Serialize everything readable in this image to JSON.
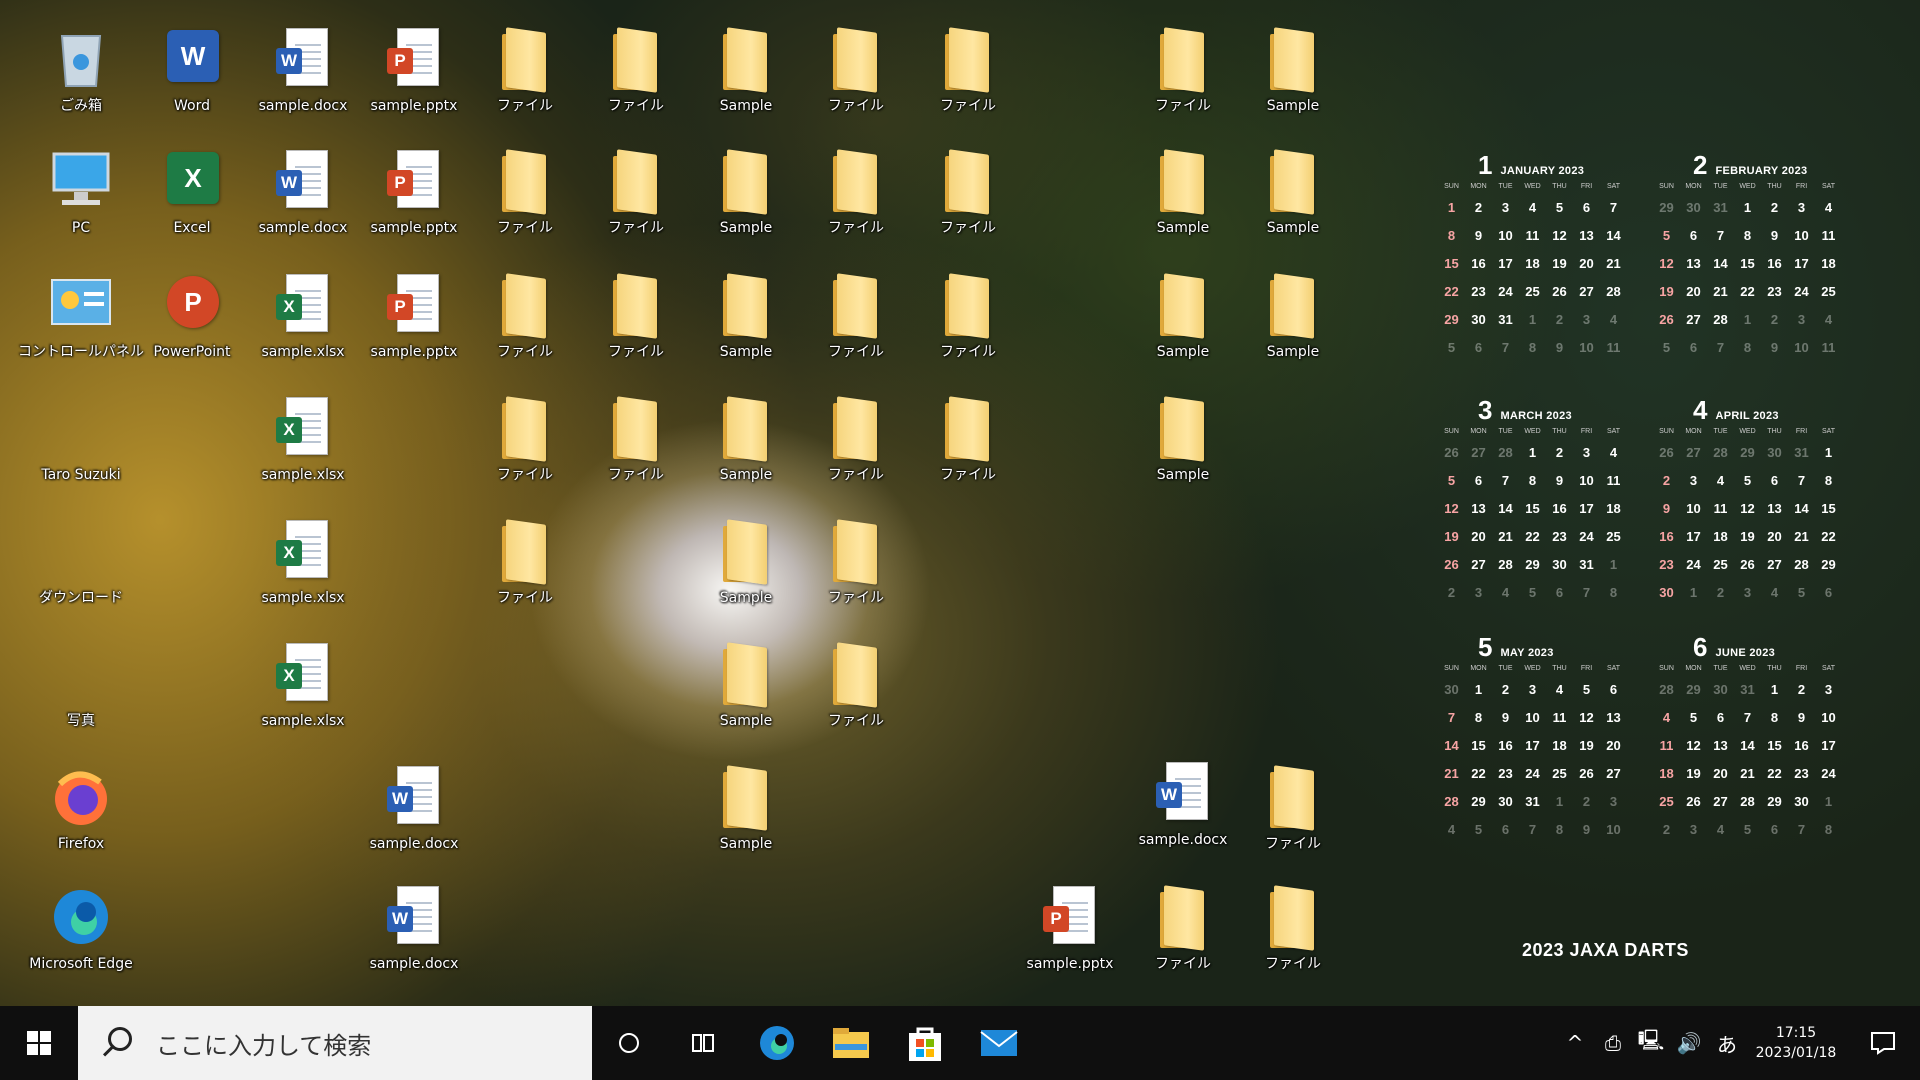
{
  "desktop": {
    "col1": [
      {
        "label": "ごみ箱",
        "icon": "recycle-bin-icon",
        "kind": "bin"
      },
      {
        "label": "PC",
        "icon": "pc-icon",
        "kind": "pc"
      },
      {
        "label": "コントロールパネル",
        "icon": "control-panel-icon",
        "kind": "cp"
      },
      {
        "label": "Taro Suzuki",
        "icon": "user-folder-icon",
        "kind": "folder"
      },
      {
        "label": "ダウンロード",
        "icon": "downloads-folder-icon",
        "kind": "folder"
      },
      {
        "label": "写真",
        "icon": "pictures-folder-icon",
        "kind": "folder"
      },
      {
        "label": "Firefox",
        "icon": "firefox-icon",
        "kind": "firefox"
      },
      {
        "label": "Microsoft Edge",
        "icon": "edge-icon",
        "kind": "edge"
      }
    ],
    "col2": [
      {
        "label": "Word",
        "icon": "word-app-icon"
      },
      {
        "label": "Excel",
        "icon": "excel-app-icon"
      },
      {
        "label": "PowerPoint",
        "icon": "powerpoint-app-icon"
      }
    ],
    "col3": [
      "sample.docx",
      "sample.docx",
      "sample.xlsx",
      "sample.xlsx",
      "sample.xlsx",
      "sample.xlsx"
    ],
    "col4": [
      "sample.pptx",
      "sample.pptx",
      "sample.pptx",
      "sample.docx",
      "sample.docx"
    ],
    "folders": {
      "file_label": "ファイル",
      "sample_label": "Sample"
    },
    "bottom_right": [
      "sample.docx",
      "ファイル",
      "sample.pptx",
      "ファイル",
      "ファイル"
    ]
  },
  "calendar": {
    "dow": [
      "SUN",
      "MON",
      "TUE",
      "WED",
      "THU",
      "FRI",
      "SAT"
    ],
    "months": [
      {
        "num": "1",
        "name": "JANUARY 2023",
        "weeks": [
          [
            "1",
            "2",
            "3",
            "4",
            "5",
            "6",
            "7"
          ],
          [
            "8",
            "9",
            "10",
            "11",
            "12",
            "13",
            "14"
          ],
          [
            "15",
            "16",
            "17",
            "18",
            "19",
            "20",
            "21"
          ],
          [
            "22",
            "23",
            "24",
            "25",
            "26",
            "27",
            "28"
          ],
          [
            "29",
            "30",
            "31",
            "1",
            "2",
            "3",
            "4"
          ],
          [
            "5",
            "6",
            "7",
            "8",
            "9",
            "10",
            "11"
          ]
        ]
      },
      {
        "num": "2",
        "name": "FEBRUARY 2023",
        "weeks": [
          [
            "29",
            "30",
            "31",
            "1",
            "2",
            "3",
            "4"
          ],
          [
            "5",
            "6",
            "7",
            "8",
            "9",
            "10",
            "11"
          ],
          [
            "12",
            "13",
            "14",
            "15",
            "16",
            "17",
            "18"
          ],
          [
            "19",
            "20",
            "21",
            "22",
            "23",
            "24",
            "25"
          ],
          [
            "26",
            "27",
            "28",
            "1",
            "2",
            "3",
            "4"
          ],
          [
            "5",
            "6",
            "7",
            "8",
            "9",
            "10",
            "11"
          ]
        ]
      },
      {
        "num": "3",
        "name": "MARCH 2023",
        "weeks": [
          [
            "26",
            "27",
            "28",
            "1",
            "2",
            "3",
            "4"
          ],
          [
            "5",
            "6",
            "7",
            "8",
            "9",
            "10",
            "11"
          ],
          [
            "12",
            "13",
            "14",
            "15",
            "16",
            "17",
            "18"
          ],
          [
            "19",
            "20",
            "21",
            "22",
            "23",
            "24",
            "25"
          ],
          [
            "26",
            "27",
            "28",
            "29",
            "30",
            "31",
            "1"
          ],
          [
            "2",
            "3",
            "4",
            "5",
            "6",
            "7",
            "8"
          ]
        ]
      },
      {
        "num": "4",
        "name": "APRIL 2023",
        "weeks": [
          [
            "26",
            "27",
            "28",
            "29",
            "30",
            "31",
            "1"
          ],
          [
            "2",
            "3",
            "4",
            "5",
            "6",
            "7",
            "8"
          ],
          [
            "9",
            "10",
            "11",
            "12",
            "13",
            "14",
            "15"
          ],
          [
            "16",
            "17",
            "18",
            "19",
            "20",
            "21",
            "22"
          ],
          [
            "23",
            "24",
            "25",
            "26",
            "27",
            "28",
            "29"
          ],
          [
            "30",
            "1",
            "2",
            "3",
            "4",
            "5",
            "6"
          ]
        ]
      },
      {
        "num": "5",
        "name": "MAY 2023",
        "weeks": [
          [
            "30",
            "1",
            "2",
            "3",
            "4",
            "5",
            "6"
          ],
          [
            "7",
            "8",
            "9",
            "10",
            "11",
            "12",
            "13"
          ],
          [
            "14",
            "15",
            "16",
            "17",
            "18",
            "19",
            "20"
          ],
          [
            "21",
            "22",
            "23",
            "24",
            "25",
            "26",
            "27"
          ],
          [
            "28",
            "29",
            "30",
            "31",
            "1",
            "2",
            "3"
          ],
          [
            "4",
            "5",
            "6",
            "7",
            "8",
            "9",
            "10"
          ]
        ]
      },
      {
        "num": "6",
        "name": "JUNE 2023",
        "weeks": [
          [
            "28",
            "29",
            "30",
            "31",
            "1",
            "2",
            "3"
          ],
          [
            "4",
            "5",
            "6",
            "7",
            "8",
            "9",
            "10"
          ],
          [
            "11",
            "12",
            "13",
            "14",
            "15",
            "16",
            "17"
          ],
          [
            "18",
            "19",
            "20",
            "21",
            "22",
            "23",
            "24"
          ],
          [
            "25",
            "26",
            "27",
            "28",
            "29",
            "30",
            "1"
          ],
          [
            "2",
            "3",
            "4",
            "5",
            "6",
            "7",
            "8"
          ]
        ]
      }
    ],
    "brand": "2023  JAXA  DARTS"
  },
  "taskbar": {
    "search_placeholder": "ここに入力して検索",
    "apps": [
      "cortana-icon",
      "task-view-icon",
      "edge-taskbar-icon",
      "file-explorer-icon",
      "store-icon",
      "mail-icon"
    ],
    "tray": [
      "^",
      "⎙",
      "🖳",
      "🔊",
      "あ"
    ],
    "time": "17:15",
    "date": "2023/01/18"
  },
  "colors": {
    "word": "#2b5fb4",
    "excel": "#1e7b45",
    "powerpoint": "#d24726",
    "taskbar": "#0f0f0f"
  }
}
